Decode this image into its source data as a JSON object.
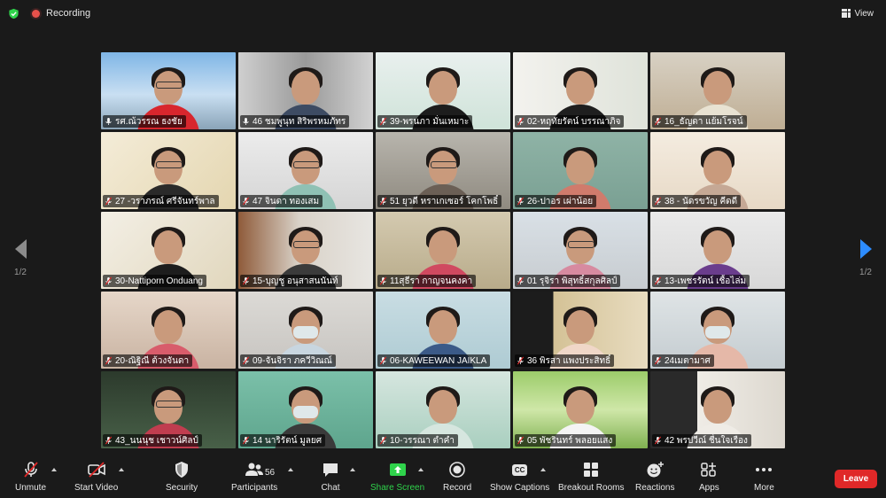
{
  "topbar": {
    "recording_label": "Recording",
    "view_label": "View"
  },
  "pager": {
    "left_page": "1/2",
    "right_page": "1/2"
  },
  "colors": {
    "accent": "#2d8cff",
    "active_speaker": "#c8e06b",
    "leave": "#e02828",
    "share_green": "#2fd34b",
    "recording": "#e8514b"
  },
  "participants": [
    {
      "name": "รศ.ณ้วรรณ ธงชัย",
      "mic": "on"
    },
    {
      "name": "46 ชมพูนุท สิริพรหมภัทร",
      "mic": "on",
      "active": true
    },
    {
      "name": "39-พรนภา มั่นเหมาะ",
      "mic": "muted"
    },
    {
      "name": "02-หฤทัยรัตน์ บรรณาภิจ",
      "mic": "muted"
    },
    {
      "name": "16_ธัญดา แย้มโรจน์",
      "mic": "muted"
    },
    {
      "name": "27 -วราภรณ์ ศรีจันทร์พาล",
      "mic": "muted"
    },
    {
      "name": "47 จินดา ทองเสม",
      "mic": "muted"
    },
    {
      "name": "51 ยุวดี หราเกเซอร์ โคกโพธิ์",
      "mic": "muted"
    },
    {
      "name": "26-ปาอร เผ่าน้อย",
      "mic": "muted"
    },
    {
      "name": "38 - นัดรขวัญ คีดดี",
      "mic": "muted"
    },
    {
      "name": "30-Nattiporn Onduang",
      "mic": "muted"
    },
    {
      "name": "15-บุญชู อนุสาสนนันท์",
      "mic": "muted"
    },
    {
      "name": "11สุธีรา กาญจนคงคา",
      "mic": "muted"
    },
    {
      "name": "01 รุจิรา พิสุทธิ์สกุลศิลป์",
      "mic": "muted"
    },
    {
      "name": "13-เพชรรัตน์ เชื้อไล่ม",
      "mic": "muted"
    },
    {
      "name": "20-ณิฐิณี ต้วงจันดา",
      "mic": "muted"
    },
    {
      "name": "09-จันจิรา ภควีวิณณ์",
      "mic": "muted"
    },
    {
      "name": "06-KAWEEWAN JAIKLA",
      "mic": "muted"
    },
    {
      "name": "36 พิรสา แพงประสิทธิ์",
      "mic": "muted"
    },
    {
      "name": "24เมตามาศ",
      "mic": "muted"
    },
    {
      "name": "43_นนนุช เชาวน์ศิลป์",
      "mic": "muted"
    },
    {
      "name": "14 นาริรัตน์ มูลยศ",
      "mic": "muted"
    },
    {
      "name": "10-วรรณา ตำคำ",
      "mic": "muted"
    },
    {
      "name": "05 พัชรินทร์ พลอยแสง",
      "mic": "muted"
    },
    {
      "name": "42 พรปวีณ์ ชื่นใจเรือง",
      "mic": "muted"
    }
  ],
  "toolbar": {
    "unmute": "Unmute",
    "start_video": "Start Video",
    "security": "Security",
    "participants": "Participants",
    "participants_count": "56",
    "chat": "Chat",
    "share_screen": "Share Screen",
    "record": "Record",
    "show_captions": "Show Captions",
    "cc_icon_text": "CC",
    "breakout_rooms": "Breakout Rooms",
    "reactions": "Reactions",
    "apps": "Apps",
    "more": "More",
    "leave": "Leave"
  }
}
